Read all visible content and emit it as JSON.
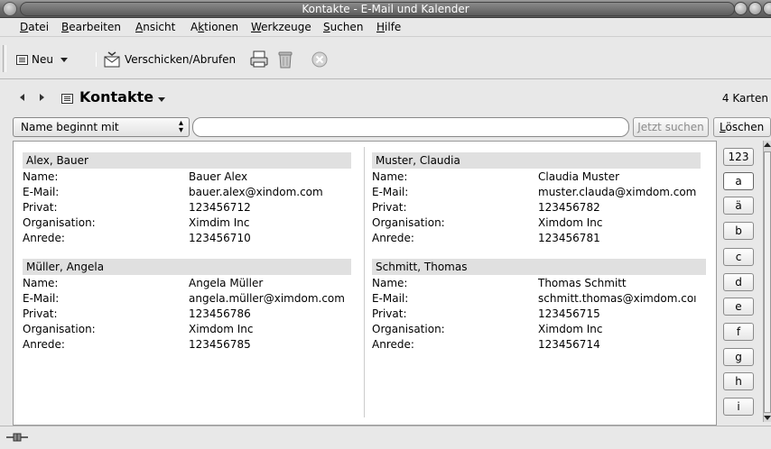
{
  "window": {
    "title": "Kontakte - E-Mail und Kalender"
  },
  "menu": [
    {
      "u": "D",
      "rest": "atei"
    },
    {
      "u": "B",
      "rest": "earbeiten"
    },
    {
      "u": "A",
      "rest": "nsicht"
    },
    {
      "pre": "A",
      "u": "k",
      "rest": "tionen"
    },
    {
      "u": "W",
      "rest": "erkzeuge"
    },
    {
      "u": "S",
      "rest": "uchen"
    },
    {
      "u": "H",
      "rest": "ilfe"
    }
  ],
  "toolbar": {
    "new_label": "Neu",
    "send_receive_label": "Verschicken/Abrufen"
  },
  "location": {
    "folder_title": "Kontakte",
    "card_count": "4 Karten"
  },
  "search": {
    "filter_value": "Name beginnt mit",
    "query_value": "",
    "search_button_u": "J",
    "search_button_rest": "etzt suchen",
    "clear_button_u": "L",
    "clear_button_rest": "öschen"
  },
  "labels": {
    "name": "Name:",
    "email": "E-Mail:",
    "private": "Privat:",
    "organisation": "Organisation:",
    "salutation": "Anrede:"
  },
  "contacts": [
    {
      "header": "Alex, Bauer",
      "name": "Bauer Alex",
      "email": "bauer.alex@xindom.com",
      "private": "123456712",
      "organisation": "Ximdim Inc",
      "salutation": "123456710"
    },
    {
      "header": "Müller, Angela",
      "name": "Angela Müller",
      "email": "angela.müller@ximdom.com",
      "private": "123456786",
      "organisation": "Ximdom Inc",
      "salutation": "123456785"
    },
    {
      "header": "Muster, Claudia",
      "name": "Claudia Muster",
      "email": "muster.clauda@ximdom.com",
      "private": "123456782",
      "organisation": "Ximdom Inc",
      "salutation": "123456781"
    },
    {
      "header": "Schmitt, Thomas",
      "name": "Thomas Schmitt",
      "email": "schmitt.thomas@ximdom.coı",
      "private": "123456715",
      "organisation": "Ximdom Inc",
      "salutation": "123456714"
    }
  ],
  "letters": [
    "123",
    "a",
    "ä",
    "b",
    "c",
    "d",
    "e",
    "f",
    "g",
    "h",
    "i"
  ]
}
